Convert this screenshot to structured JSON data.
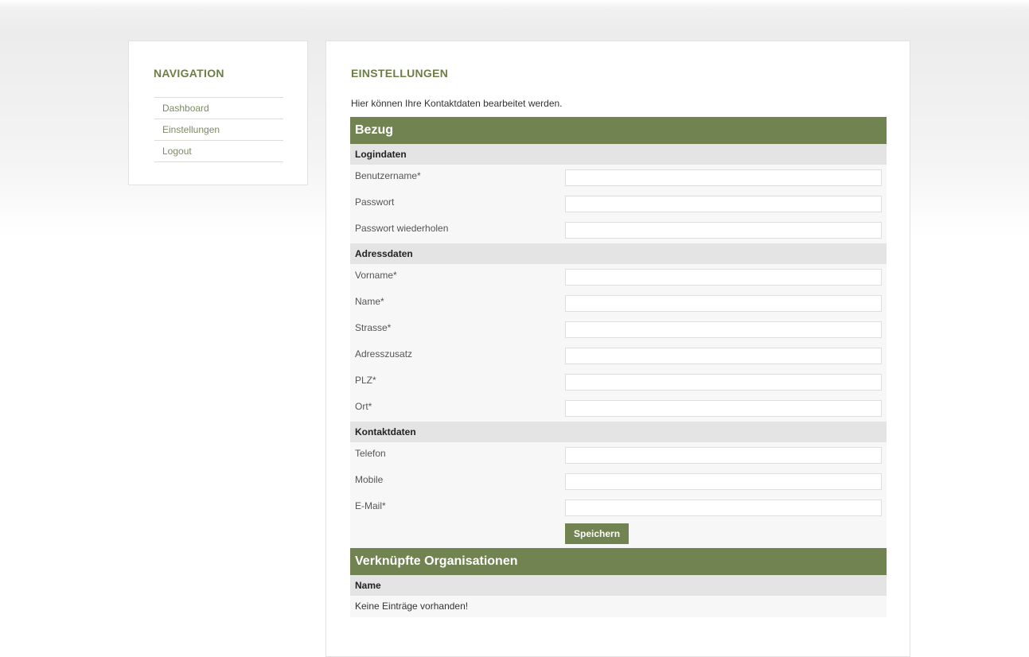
{
  "navigation": {
    "title": "NAVIGATION",
    "items": [
      {
        "label": "Dashboard"
      },
      {
        "label": "Einstellungen"
      },
      {
        "label": "Logout"
      }
    ]
  },
  "main": {
    "title": "EINSTELLUNGEN",
    "intro": "Hier können Ihre Kontaktdaten bearbeitet werden.",
    "section_bezug": "Bezug",
    "logindaten": {
      "header": "Logindaten",
      "fields": [
        {
          "label": "Benutzername*",
          "value": ""
        },
        {
          "label": "Passwort",
          "value": ""
        },
        {
          "label": "Passwort wiederholen",
          "value": ""
        }
      ]
    },
    "adressdaten": {
      "header": "Adressdaten",
      "fields": [
        {
          "label": "Vorname*",
          "value": ""
        },
        {
          "label": "Name*",
          "value": ""
        },
        {
          "label": "Strasse*",
          "value": ""
        },
        {
          "label": "Adresszusatz",
          "value": ""
        },
        {
          "label": "PLZ*",
          "value": ""
        },
        {
          "label": "Ort*",
          "value": ""
        }
      ]
    },
    "kontaktdaten": {
      "header": "Kontaktdaten",
      "fields": [
        {
          "label": "Telefon",
          "value": ""
        },
        {
          "label": "Mobile",
          "value": ""
        },
        {
          "label": "E-Mail*",
          "value": ""
        }
      ]
    },
    "save_label": "Speichern",
    "section_orgs": "Verknüpfte Organisationen",
    "orgs_column": "Name",
    "orgs_empty": "Keine Einträge vorhanden!"
  },
  "colors": {
    "accent": "#718350",
    "heading": "#6b7f45",
    "nav_link": "#7c8a62"
  }
}
